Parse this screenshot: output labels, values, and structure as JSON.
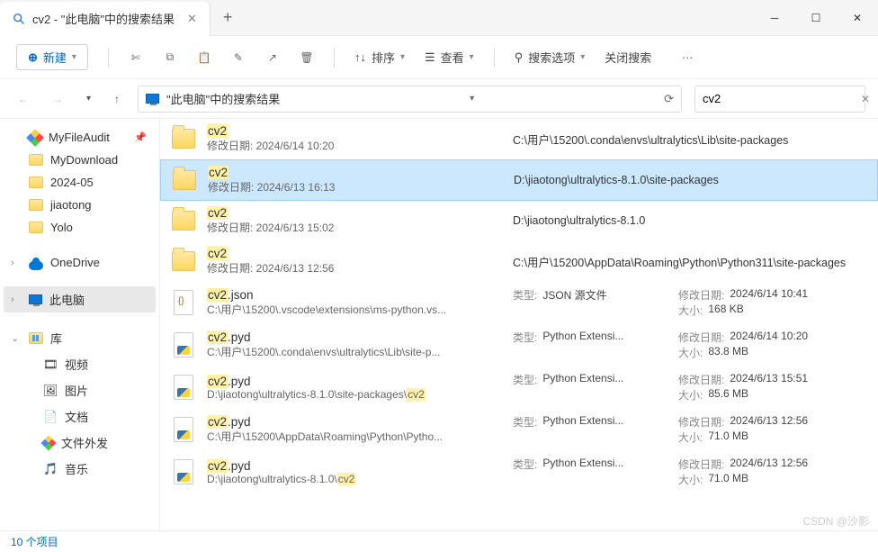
{
  "tab": {
    "title": "cv2 - \"此电脑\"中的搜索结果"
  },
  "toolbar": {
    "new": "新建",
    "sort": "排序",
    "view": "查看",
    "search_options": "搜索选项",
    "close_search": "关闭搜索"
  },
  "address": {
    "label": "\"此电脑\"中的搜索结果"
  },
  "search": {
    "value": "cv2"
  },
  "sidebar": {
    "myfileaudit": "MyFileAudit",
    "mydownload": "MyDownload",
    "date_folder": "2024-05",
    "jiaotong": "jiaotong",
    "yolo": "Yolo",
    "onedrive": "OneDrive",
    "thispc": "此电脑",
    "library": "库",
    "videos": "视频",
    "pictures": "图片",
    "documents": "文档",
    "fileshare": "文件外发",
    "music": "音乐"
  },
  "labels": {
    "modified": "修改日期:",
    "type": "类型:",
    "size": "大小:"
  },
  "results": [
    {
      "icon": "folder",
      "name_hl": "cv2",
      "name_rest": "",
      "sub": "2024/6/14 10:20",
      "path": "C:\\用户\\15200\\.conda\\envs\\ultralytics\\Lib\\site-packages",
      "selected": false
    },
    {
      "icon": "folder",
      "name_hl": "cv2",
      "name_rest": "",
      "sub": "2024/6/13 16:13",
      "path": "D:\\jiaotong\\ultralytics-8.1.0\\site-packages",
      "selected": true
    },
    {
      "icon": "folder",
      "name_hl": "cv2",
      "name_rest": "",
      "sub": "2024/6/13 15:02",
      "path": "D:\\jiaotong\\ultralytics-8.1.0",
      "selected": false
    },
    {
      "icon": "folder",
      "name_hl": "cv2",
      "name_rest": "",
      "sub": "2024/6/13 12:56",
      "path": "C:\\用户\\15200\\AppData\\Roaming\\Python\\Python311\\site-packages",
      "selected": false
    },
    {
      "icon": "json",
      "name_hl": "cv2",
      "name_rest": ".json",
      "sub_path": "C:\\用户\\15200\\.vscode\\extensions\\ms-python.vs...",
      "type": "JSON 源文件",
      "modified": "2024/6/14 10:41",
      "size": "168 KB"
    },
    {
      "icon": "pyd",
      "name_hl": "cv2",
      "name_rest": ".pyd",
      "sub_path": "C:\\用户\\15200\\.conda\\envs\\ultralytics\\Lib\\site-p...",
      "type": "Python Extensi...",
      "modified": "2024/6/14 10:20",
      "size": "83.8 MB"
    },
    {
      "icon": "pyd",
      "name_hl": "cv2",
      "name_rest": ".pyd",
      "sub_path_pre": "D:\\jiaotong\\ultralytics-8.1.0\\site-packages\\",
      "sub_path_hl": "cv2",
      "type": "Python Extensi...",
      "modified": "2024/6/13 15:51",
      "size": "85.6 MB"
    },
    {
      "icon": "pyd",
      "name_hl": "cv2",
      "name_rest": ".pyd",
      "sub_path": "C:\\用户\\15200\\AppData\\Roaming\\Python\\Pytho...",
      "type": "Python Extensi...",
      "modified": "2024/6/13 12:56",
      "size": "71.0 MB"
    },
    {
      "icon": "pyd",
      "name_hl": "cv2",
      "name_rest": ".pyd",
      "sub_path_pre": "D:\\jiaotong\\ultralytics-8.1.0\\",
      "sub_path_hl": "cv2",
      "type": "Python Extensi...",
      "modified": "2024/6/13 12:56",
      "size": "71.0 MB"
    }
  ],
  "status": "10 个项目",
  "watermark": "CSDN @沙影"
}
